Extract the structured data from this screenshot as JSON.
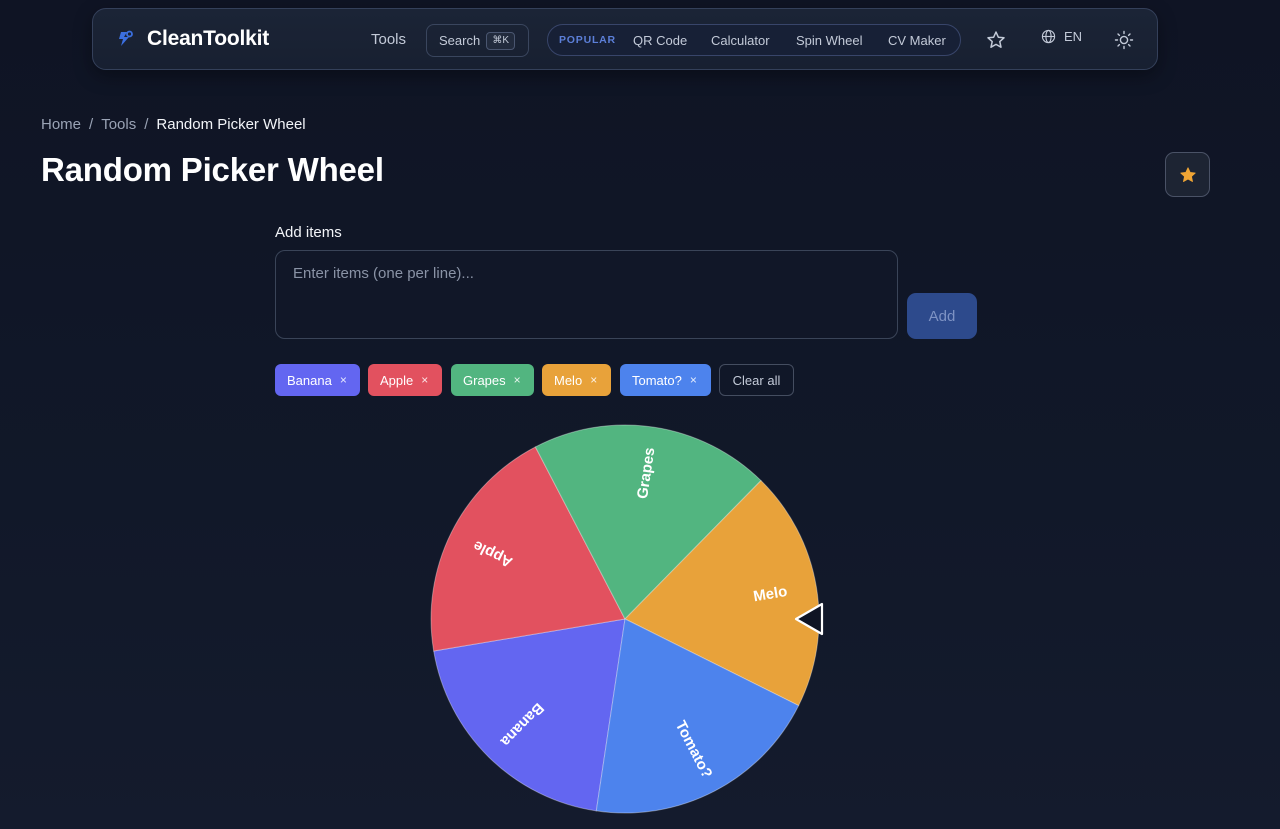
{
  "nav": {
    "logo": "CleanToolkit",
    "tools": "Tools",
    "search": "Search",
    "search_kbd": "⌘K",
    "popular": "POPULAR",
    "links": [
      "QR Code",
      "Calculator",
      "Spin Wheel",
      "CV Maker"
    ],
    "lang": "EN"
  },
  "breadcrumb": {
    "home": "Home",
    "tools": "Tools",
    "current": "Random Picker Wheel",
    "sep": "/"
  },
  "page": {
    "title": "Random Picker Wheel",
    "add_label": "Add items",
    "input_placeholder": "Enter items (one per line)...",
    "add_button": "Add",
    "clear_all": "Clear all",
    "remove_glyph": "×"
  },
  "items": [
    {
      "label": "Banana",
      "color": "#6366f1"
    },
    {
      "label": "Apple",
      "color": "#e2515f"
    },
    {
      "label": "Grapes",
      "color": "#52b580"
    },
    {
      "label": "Melo",
      "color": "#e8a23a"
    },
    {
      "label": "Tomato?",
      "color": "#4d83ed"
    }
  ],
  "colors": {
    "accent": "#3b6fe0",
    "star": "#f0a535"
  },
  "icons": [
    "logo-icon",
    "star-icon",
    "globe-icon",
    "sun-icon",
    "pointer-icon"
  ]
}
